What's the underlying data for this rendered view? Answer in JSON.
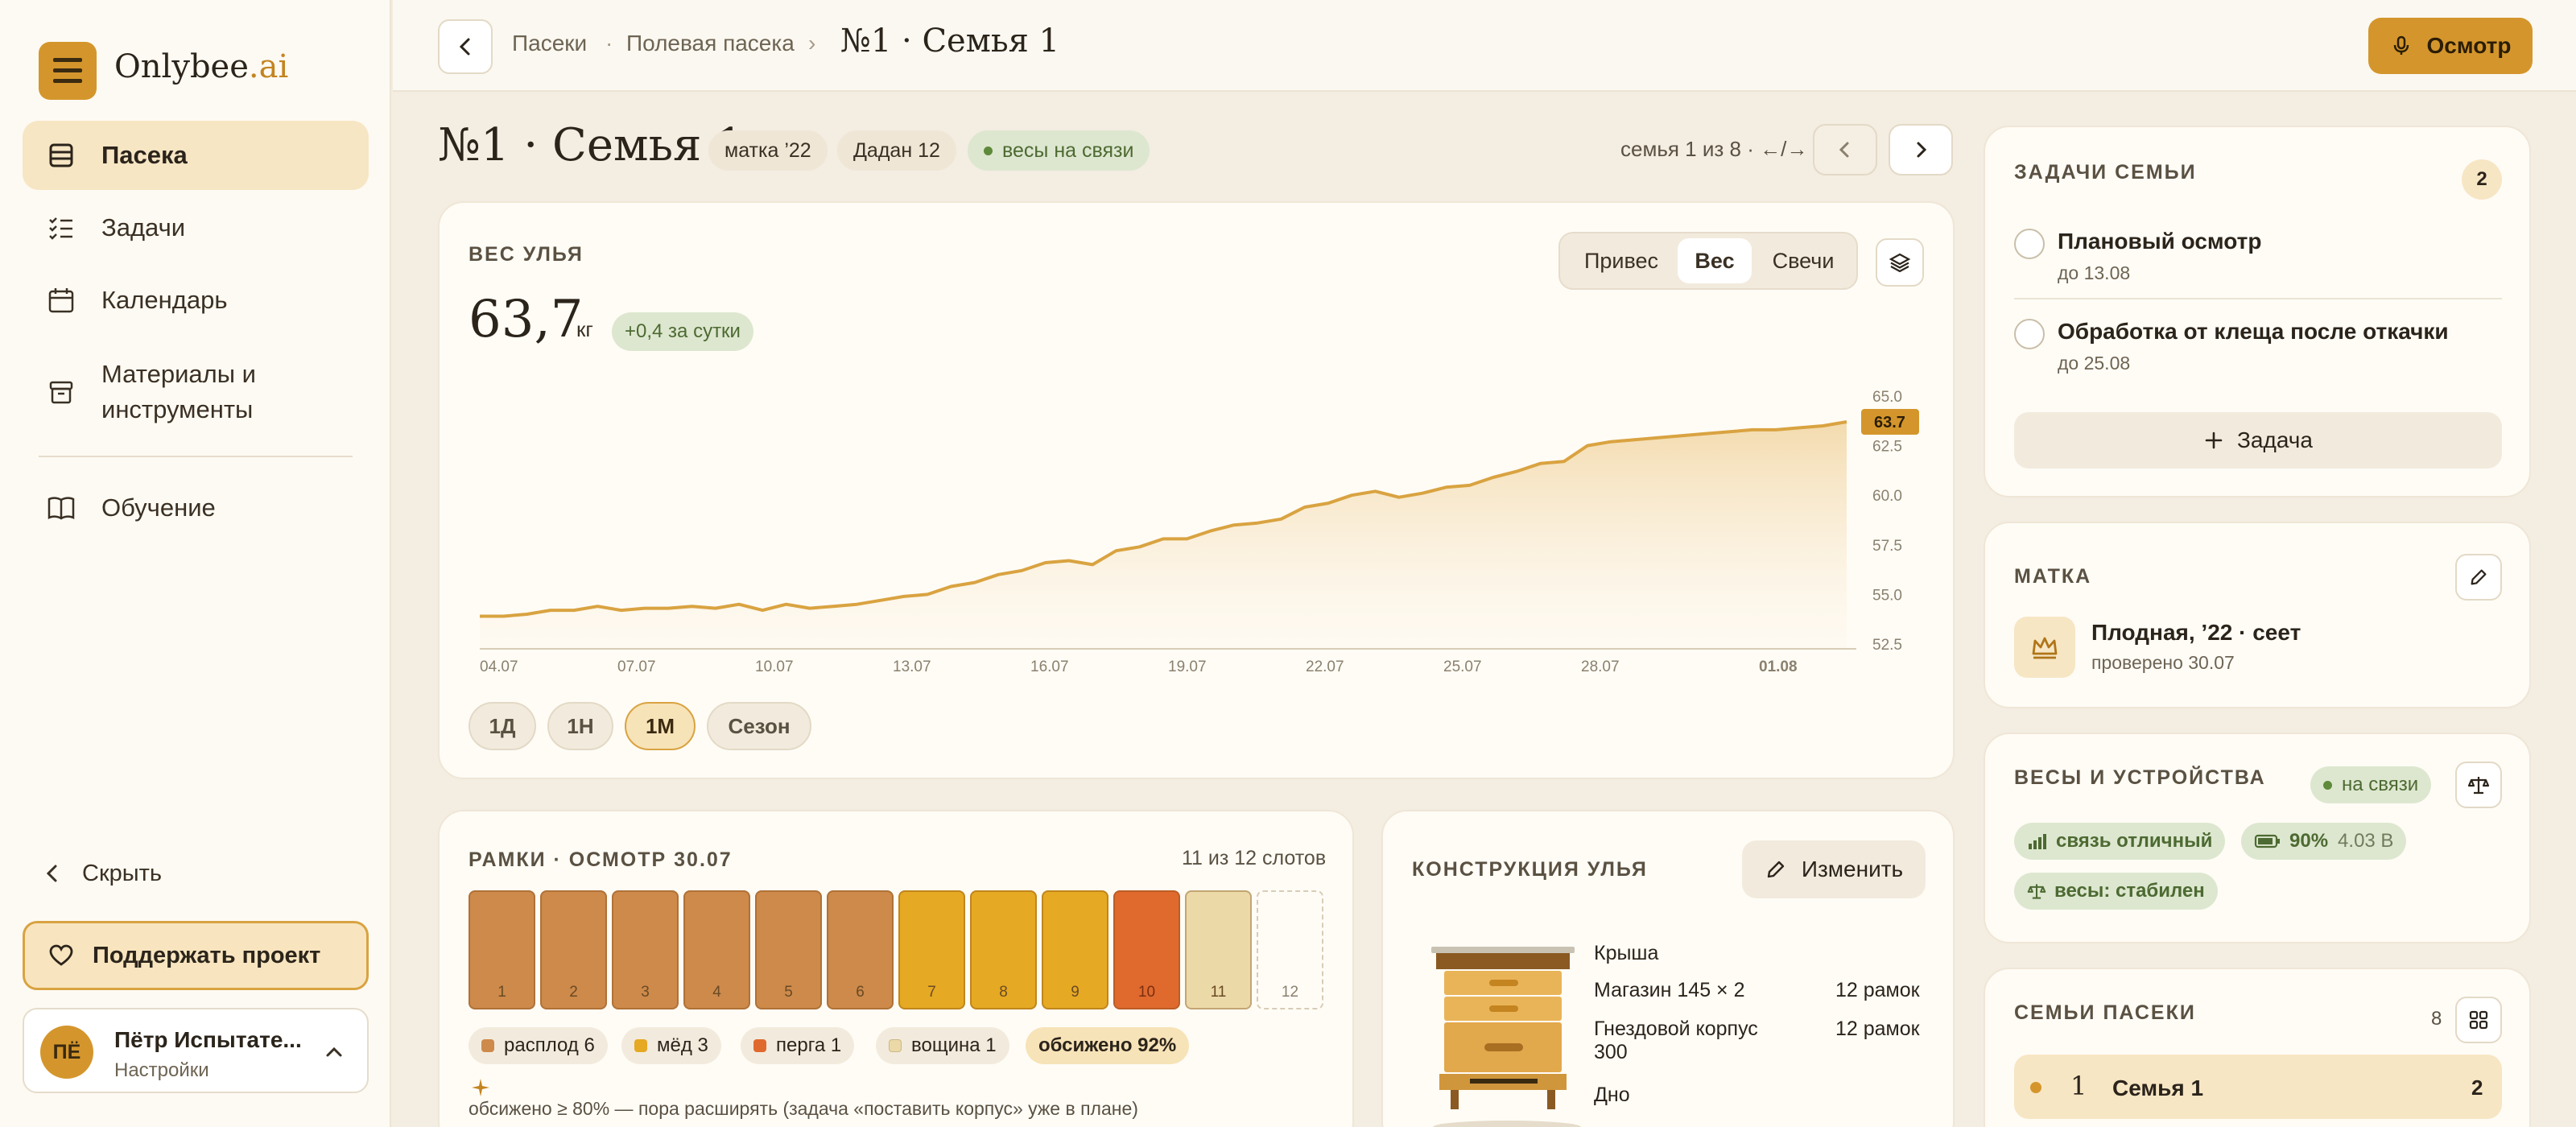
{
  "app": {
    "brand_main": "Onlybee",
    "brand_suffix": ".ai"
  },
  "nav": {
    "items": [
      {
        "label": "Пасека",
        "icon": "hive-icon",
        "active": true
      },
      {
        "label": "Задачи",
        "icon": "checklist-icon"
      },
      {
        "label": "Календарь",
        "icon": "calendar-icon"
      },
      {
        "label_line1": "Материалы и",
        "label_line2": "инструменты",
        "icon": "box-icon"
      },
      {
        "label": "Обучение",
        "icon": "book-icon"
      }
    ],
    "hide_label": "Скрыть",
    "support_label": "Поддержать проект"
  },
  "user": {
    "initials": "ПЁ",
    "name": "Пётр Испытате...",
    "settings": "Настройки"
  },
  "header": {
    "breadcrumb": [
      "Пасеки",
      "Полевая пасека"
    ],
    "breadcrumb_sep1": "·",
    "breadcrumb_sep2": "›",
    "title": "№1 · Семья 1",
    "inspect_label": "Осмотр"
  },
  "page": {
    "title": "№1 · Семья 1",
    "chips": [
      "матка ’22",
      "Дадан 12"
    ],
    "status_chip": "весы на связи",
    "family_nav": "семья 1 из 8 · ←/→"
  },
  "weight": {
    "label": "ВЕС УЛЬЯ",
    "tabs": [
      "Привес",
      "Вес",
      "Свечи"
    ],
    "active_tab": "Вес",
    "value": "63,7",
    "unit": "кг",
    "delta": "+0,4 за сутки",
    "ranges": [
      "1Д",
      "1Н",
      "1М",
      "Сезон"
    ],
    "active_range": "1М"
  },
  "chart_data": {
    "type": "area",
    "x_ticks": [
      "04.07",
      "07.07",
      "10.07",
      "13.07",
      "16.07",
      "19.07",
      "22.07",
      "25.07",
      "28.07",
      "01.08"
    ],
    "y_ticks": [
      "65.0",
      "62.5",
      "60.0",
      "57.5",
      "55.0",
      "52.5"
    ],
    "ylim": [
      52.5,
      65.0
    ],
    "current_label": "63.7",
    "series": [
      {
        "values": [
          53.9,
          53.9,
          54.0,
          54.2,
          54.2,
          54.4,
          54.2,
          54.3,
          54.3,
          54.4,
          54.3,
          54.5,
          54.2,
          54.5,
          54.3,
          54.4,
          54.5,
          54.7,
          54.9,
          55.0,
          55.4,
          55.6,
          56.0,
          56.2,
          56.6,
          56.7,
          56.5,
          57.2,
          57.4,
          57.8,
          57.8,
          58.2,
          58.5,
          58.6,
          58.8,
          59.4,
          59.6,
          60.0,
          60.2,
          59.9,
          60.1,
          60.4,
          60.5,
          60.9,
          61.2,
          61.6,
          61.7,
          62.5,
          62.7,
          62.8,
          62.9,
          63.0,
          63.1,
          63.2,
          63.3,
          63.3,
          63.4,
          63.5,
          63.7
        ]
      }
    ],
    "grid": false
  },
  "frames": {
    "label": "РАМКИ · ОСМОТР 30.07",
    "slots_info": "11 из 12 слотов",
    "items": [
      {
        "n": "1",
        "kind": "brood"
      },
      {
        "n": "2",
        "kind": "brood"
      },
      {
        "n": "3",
        "kind": "brood"
      },
      {
        "n": "4",
        "kind": "brood"
      },
      {
        "n": "5",
        "kind": "brood"
      },
      {
        "n": "6",
        "kind": "brood"
      },
      {
        "n": "7",
        "kind": "honey"
      },
      {
        "n": "8",
        "kind": "honey"
      },
      {
        "n": "9",
        "kind": "honey"
      },
      {
        "n": "10",
        "kind": "perga"
      },
      {
        "n": "11",
        "kind": "foundation"
      },
      {
        "n": "12",
        "kind": "empty"
      }
    ],
    "legend": [
      "расплод 6",
      "мёд 3",
      "перга 1",
      "вощина 1"
    ],
    "occupancy": "обсижено 92%",
    "hint": "обсижено ≥ 80% — пора расширять (задача «поставить корпус» уже в плане)",
    "colors": {
      "brood": "#cd8a4b",
      "honey": "#e6a923",
      "perga": "#e06a2e",
      "foundation": "#ecd9a8"
    }
  },
  "construction": {
    "label": "КОНСТРУКЦИЯ УЛЬЯ",
    "edit_label": "Изменить",
    "rows": [
      {
        "name": "Крыша",
        "count": ""
      },
      {
        "name": "Магазин 145 × 2",
        "count": "12 рамок"
      },
      {
        "name_line1": "Гнездовой корпус",
        "name_line2": "300",
        "count": "12 рамок"
      },
      {
        "name": "Дно",
        "count": ""
      }
    ]
  },
  "tasks": {
    "label": "ЗАДАЧИ СЕМЬИ",
    "count": "2",
    "items": [
      {
        "title": "Плановый осмотр",
        "due": "до 13.08"
      },
      {
        "title": "Обработка от клеща после откачки",
        "due": "до 25.08"
      }
    ],
    "add_label": "Задача"
  },
  "queen": {
    "label": "МАТКА",
    "title": "Плодная, ’22 · сеет",
    "sub": "проверено 30.07"
  },
  "scales": {
    "label": "ВЕСЫ И УСТРОЙСТВА",
    "status": "на связи",
    "signal": "связь отличный",
    "battery": "90%",
    "voltage": "4.03 В",
    "stability": "весы: стабилен"
  },
  "families": {
    "label": "СЕМЬИ ПАСЕКИ",
    "count": "8",
    "row": {
      "n": "1",
      "name": "Семья 1",
      "value": "2"
    }
  },
  "colors": {
    "accent": "#d4962c",
    "background": "#f3ede2",
    "card": "#fffcf6",
    "green": "#4d6a32"
  }
}
